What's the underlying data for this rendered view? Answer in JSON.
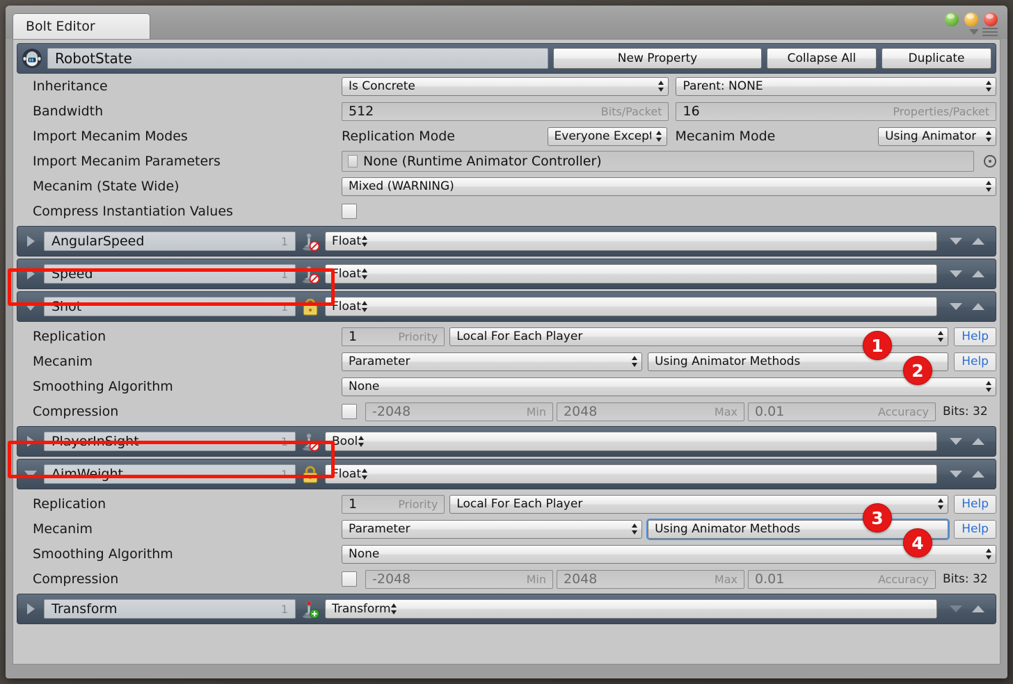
{
  "window": {
    "tab_label": "Bolt Editor",
    "controls": {
      "green": "minimize",
      "yellow": "maximize",
      "red": "close"
    },
    "menu_icon": "hamburger-icon",
    "filter_icon": "filter-icon"
  },
  "header": {
    "icon": "robot-icon",
    "state_name": "RobotState",
    "buttons": [
      {
        "label": "New Property",
        "name": "new-property-button"
      },
      {
        "label": "Collapse All",
        "name": "collapse-all-button"
      },
      {
        "label": "Duplicate",
        "name": "duplicate-button"
      }
    ]
  },
  "settings": {
    "inheritance": {
      "label": "Inheritance",
      "value": "Is Concrete",
      "parent": "Parent: NONE"
    },
    "bandwidth": {
      "label": "Bandwidth",
      "bits": "512",
      "bits_hint": "Bits/Packet",
      "props": "16",
      "props_hint": "Properties/Packet"
    },
    "import_modes": {
      "label": "Import Mecanim Modes",
      "replication_mode_label": "Replication Mode",
      "replication_mode_value": "Everyone Except",
      "mecanim_mode_label": "Mecanim Mode",
      "mecanim_mode_value": "Using Animator"
    },
    "import_params": {
      "label": "Import Mecanim Parameters",
      "value": "None (Runtime Animator Controller)"
    },
    "state_wide": {
      "label": "Mecanim (State Wide)",
      "value": "Mixed (WARNING)"
    },
    "compress": {
      "label": "Compress Instantiation Values",
      "checked": false
    }
  },
  "properties": [
    {
      "name": "AngularSpeed",
      "count": "1",
      "type": "Float",
      "expanded": false,
      "icon": "stamp-disabled-icon",
      "highlighted": false
    },
    {
      "name": "Speed",
      "count": "1",
      "type": "Float",
      "expanded": false,
      "icon": "stamp-disabled-icon",
      "highlighted": false
    },
    {
      "name": "Shot",
      "count": "1",
      "type": "Float",
      "expanded": true,
      "icon": "lock-icon",
      "highlighted": true,
      "detail": {
        "replication": {
          "label": "Replication",
          "priority": "1",
          "priority_hint": "Priority",
          "target": "Local For Each Player",
          "help": "Help",
          "badge": "1"
        },
        "mecanim": {
          "label": "Mecanim",
          "mode": "Parameter",
          "method": "Using Animator Methods",
          "help": "Help",
          "badge": "2",
          "focused": false
        },
        "smoothing": {
          "label": "Smoothing Algorithm",
          "value": "None"
        },
        "compression": {
          "label": "Compression",
          "checked": false,
          "min": "-2048",
          "min_hint": "Min",
          "max": "2048",
          "max_hint": "Max",
          "accuracy": "0.01",
          "accuracy_hint": "Accuracy",
          "bits": "Bits: 32"
        }
      }
    },
    {
      "name": "PlayerInSight",
      "count": "1",
      "type": "Bool",
      "expanded": false,
      "icon": "stamp-disabled-icon",
      "highlighted": false
    },
    {
      "name": "AimWeight",
      "count": "1",
      "type": "Float",
      "expanded": true,
      "icon": "lock-icon",
      "highlighted": true,
      "detail": {
        "replication": {
          "label": "Replication",
          "priority": "1",
          "priority_hint": "Priority",
          "target": "Local For Each Player",
          "help": "Help",
          "badge": "3"
        },
        "mecanim": {
          "label": "Mecanim",
          "mode": "Parameter",
          "method": "Using Animator Methods",
          "help": "Help",
          "badge": "4",
          "focused": true
        },
        "smoothing": {
          "label": "Smoothing Algorithm",
          "value": "None"
        },
        "compression": {
          "label": "Compression",
          "checked": false,
          "min": "-2048",
          "min_hint": "Min",
          "max": "2048",
          "max_hint": "Max",
          "accuracy": "0.01",
          "accuracy_hint": "Accuracy",
          "bits": "Bits: 32"
        }
      }
    },
    {
      "name": "Transform",
      "count": "1",
      "type": "Transform",
      "expanded": false,
      "icon": "stamp-add-icon",
      "highlighted": false,
      "last": true
    }
  ],
  "colors": {
    "accent_red": "#e61717",
    "link_blue": "#2a6ed4",
    "header_blue": "#53616f",
    "panel_gray": "#c8c8c8"
  }
}
